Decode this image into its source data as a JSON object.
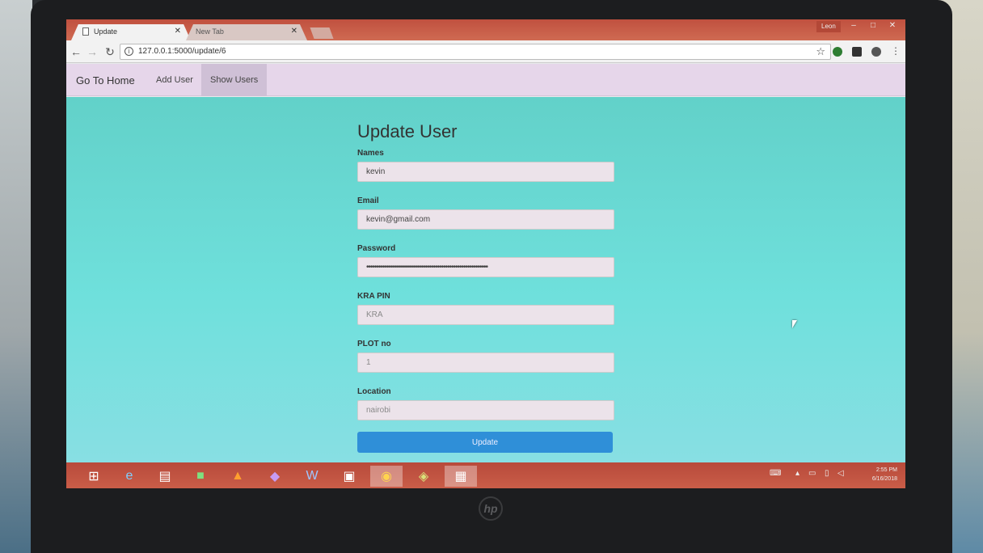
{
  "browser": {
    "tabs": [
      {
        "label": "Update",
        "active": true
      },
      {
        "label": "New Tab",
        "active": false
      }
    ],
    "user_badge": "Leon",
    "url": "127.0.0.1:5000/update/6"
  },
  "app_nav": {
    "brand": "Go To Home",
    "links": [
      {
        "label": "Add User",
        "active": false
      },
      {
        "label": "Show Users",
        "active": true
      }
    ]
  },
  "form": {
    "title": "Update User",
    "fields": [
      {
        "label": "Names",
        "value": "kevin",
        "type": "text"
      },
      {
        "label": "Email",
        "value": "kevin@gmail.com",
        "type": "email"
      },
      {
        "label": "Password",
        "value": "••••••••••••••••••••••••••••••••••••••••••••••••••••••••••••",
        "type": "password"
      },
      {
        "label": "KRA PIN",
        "placeholder": "KRA",
        "type": "text"
      },
      {
        "label": "PLOT no",
        "placeholder": "1",
        "type": "text"
      },
      {
        "label": "Location",
        "placeholder": "nairobi",
        "type": "text"
      }
    ],
    "submit_label": "Update"
  },
  "taskbar": {
    "time": "2:55 PM",
    "date": "6/16/2018"
  },
  "colors": {
    "page_background": "#6fe0dc",
    "navbar_background": "#e6d6ea",
    "submit_button": "#2f8fd8",
    "window_chrome": "#c0503f"
  }
}
